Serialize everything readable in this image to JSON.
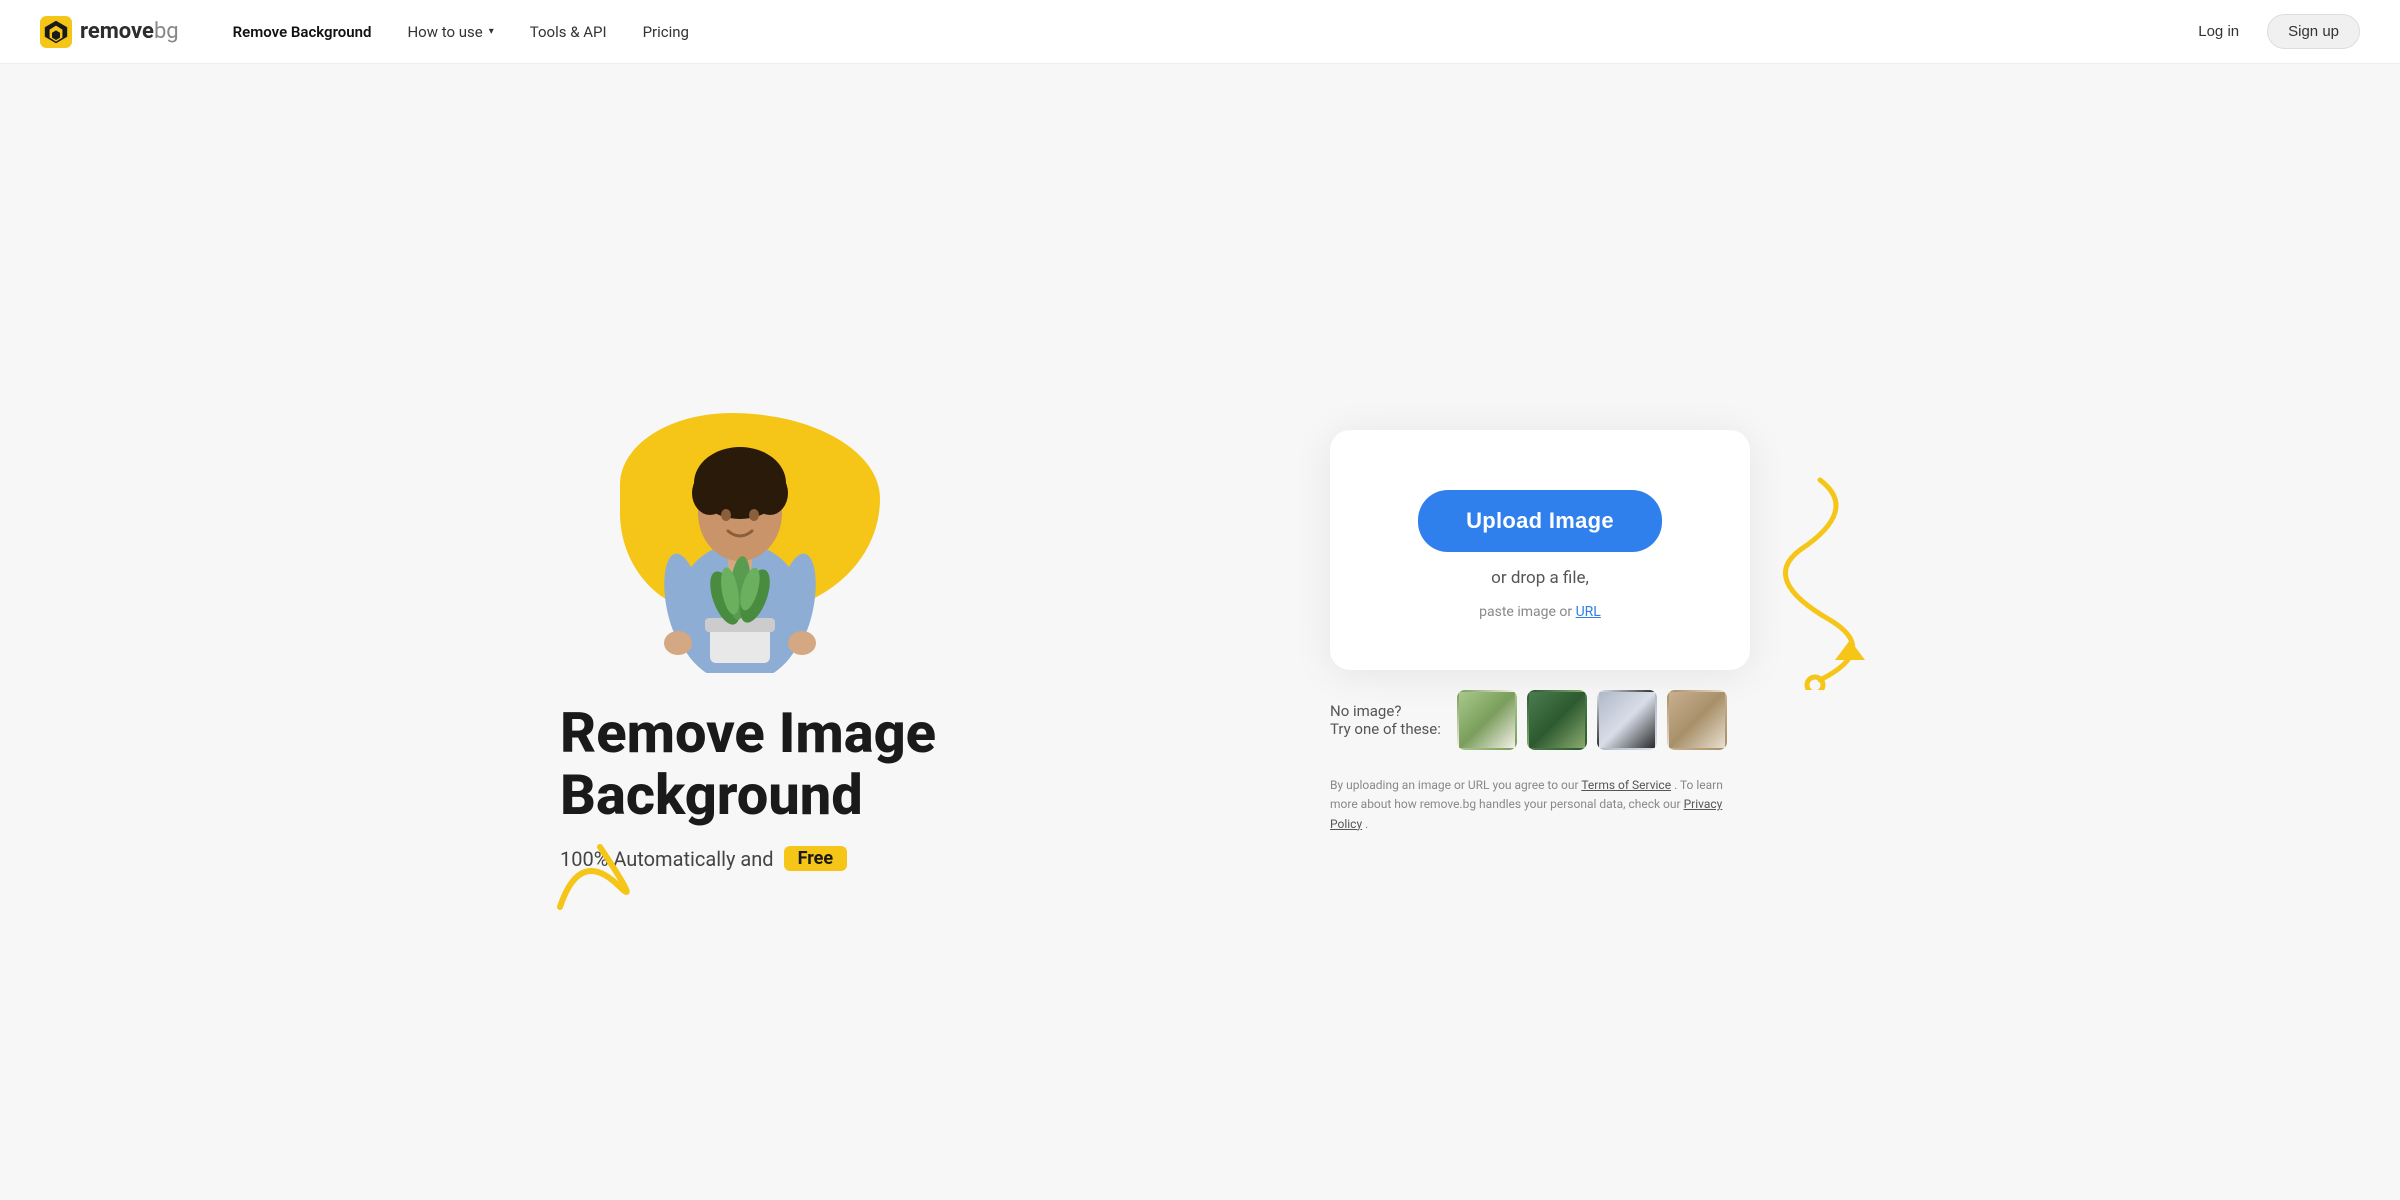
{
  "nav": {
    "logo_text_remove": "remove",
    "logo_text_bg": "bg",
    "links": [
      {
        "label": "Remove Background",
        "active": true,
        "has_dropdown": false
      },
      {
        "label": "How to use",
        "active": false,
        "has_dropdown": true
      },
      {
        "label": "Tools & API",
        "active": false,
        "has_dropdown": false
      },
      {
        "label": "Pricing",
        "active": false,
        "has_dropdown": false
      }
    ],
    "login_label": "Log in",
    "signup_label": "Sign up"
  },
  "hero": {
    "heading_line1": "Remove Image",
    "heading_line2": "Background",
    "subtext_prefix": "100% Automatically and",
    "badge_free": "Free",
    "upload_button_label": "Upload Image",
    "drop_text": "or drop a file,",
    "drop_sub_text": "paste image or",
    "drop_url_label": "URL",
    "sample_label_line1": "No image?",
    "sample_label_line2": "Try one of these:",
    "terms_text": "By uploading an image or URL you agree to our",
    "terms_of_service_label": "Terms of Service",
    "terms_mid_text": ". To learn more about how remove.bg handles your personal data, check our",
    "privacy_policy_label": "Privacy Policy",
    "terms_end": "."
  },
  "decorations": {
    "accent_color": "#f5c518"
  }
}
